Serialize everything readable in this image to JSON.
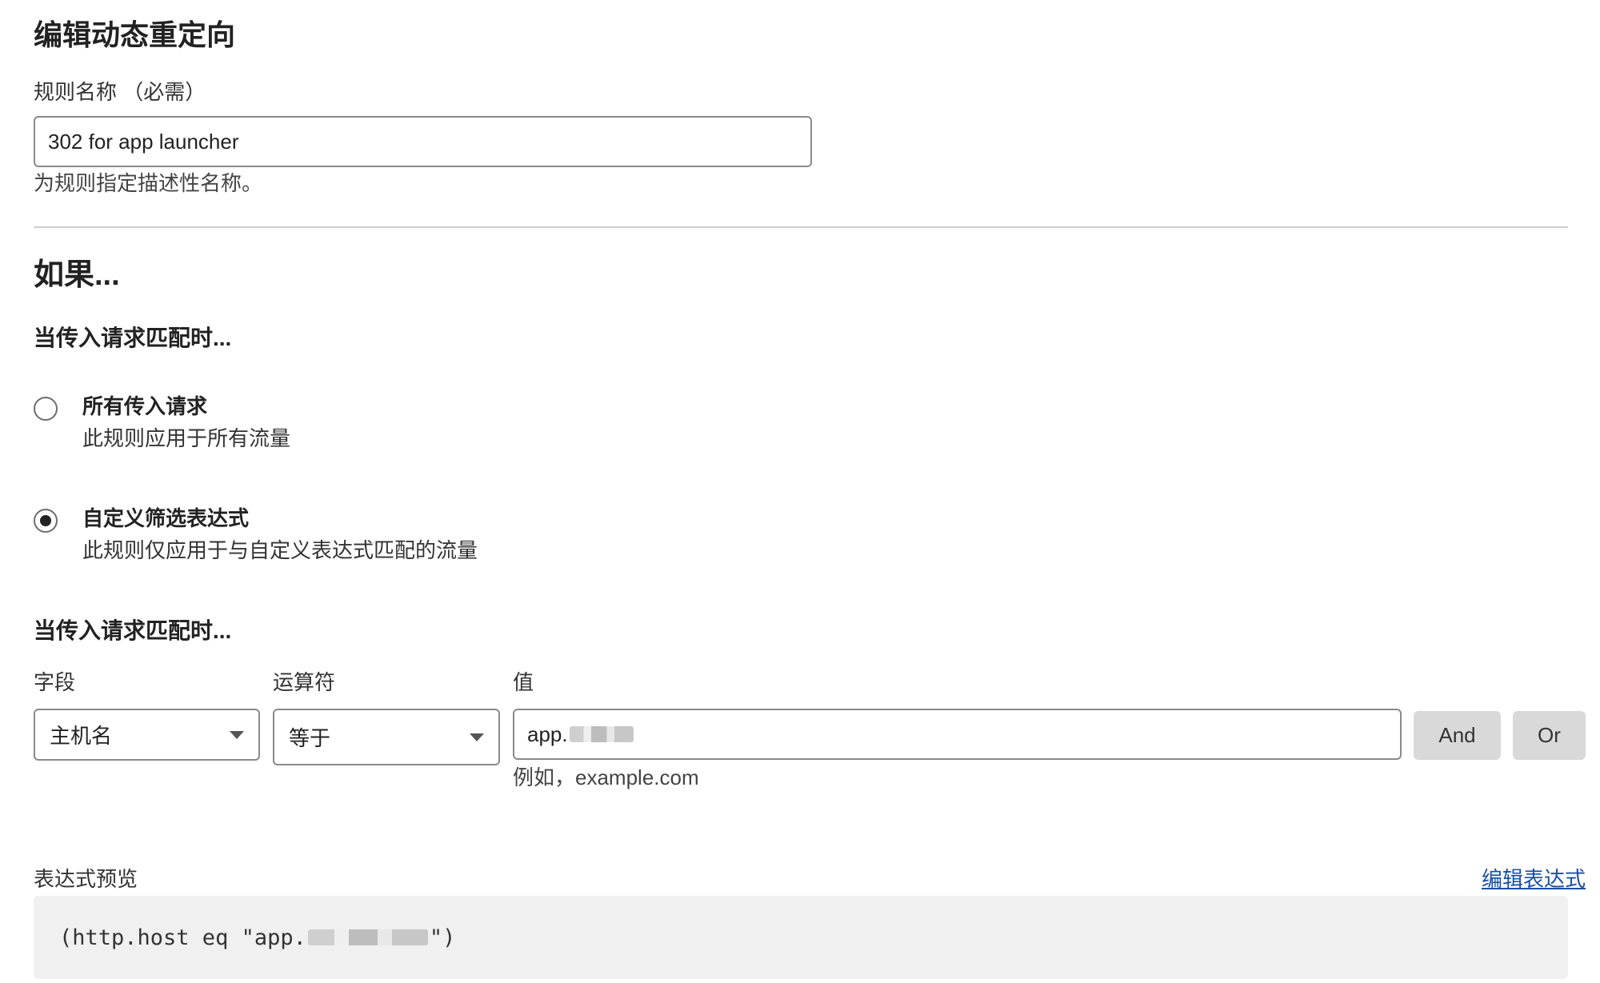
{
  "header": {
    "title": "编辑动态重定向"
  },
  "rule_name": {
    "label": "规则名称 （必需）",
    "value": "302 for app launcher",
    "help": "为规则指定描述性名称。"
  },
  "if_section": {
    "heading": "如果...",
    "match_heading": "当传入请求匹配时...",
    "options": [
      {
        "title": "所有传入请求",
        "description": "此规则应用于所有流量",
        "selected": false
      },
      {
        "title": "自定义筛选表达式",
        "description": "此规则仅应用于与自定义表达式匹配的流量",
        "selected": true
      }
    ]
  },
  "expression_builder": {
    "heading": "当传入请求匹配时...",
    "field_label": "字段",
    "operator_label": "运算符",
    "value_label": "值",
    "field_value": "主机名",
    "operator_value": "等于",
    "value_value": "app.",
    "value_help": "例如，example.com",
    "and_label": "And",
    "or_label": "Or"
  },
  "preview": {
    "label": "表达式预览",
    "edit_link": "编辑表达式",
    "code_prefix": "(http.host eq \"app.",
    "code_suffix": "\")"
  },
  "colors": {
    "link": "#1a4fa3",
    "button_bg": "#d9d9d9",
    "preview_bg": "#f0f0f0",
    "divider": "#cfcfcf"
  }
}
